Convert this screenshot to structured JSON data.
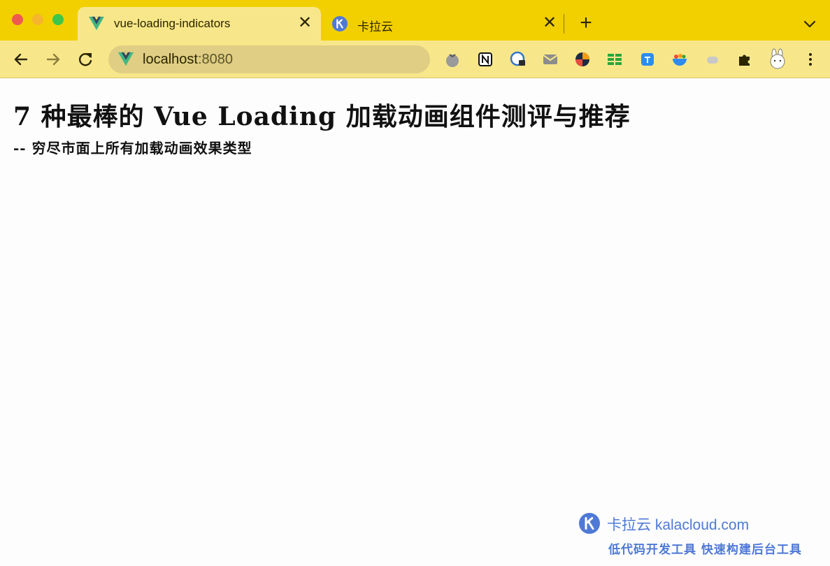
{
  "browser": {
    "tabs": [
      {
        "title": "vue-loading-indicators",
        "favicon": "vue-logo-icon",
        "active": true
      },
      {
        "title": "卡拉云",
        "favicon": "kalacloud-logo-icon",
        "active": false
      }
    ],
    "close_glyph": "✕",
    "new_tab_glyph": "+",
    "address": {
      "host": "localhost",
      "port": ":8080"
    },
    "extensions": [
      "tomato-icon",
      "notion-icon",
      "password-lock-icon",
      "mail-icon",
      "colorful-circle-icon",
      "table-grid-icon",
      "translate-icon",
      "bowl-icon",
      "cloud-icon",
      "puzzle-icon",
      "rabbit-icon"
    ],
    "colors": {
      "tabstrip": "#f2d000",
      "toolbar": "#f8e78a",
      "omnibox": "#dfce83",
      "accent_blue": "#4f79d6"
    }
  },
  "page": {
    "title": "7 种最棒的 Vue Loading 加载动画组件测评与推荐",
    "subtitle": "-- 穷尽市面上所有加载动画效果类型"
  },
  "watermark": {
    "brand": "卡拉云 kalacloud.com",
    "tagline": "低代码开发工具 快速构建后台工具"
  }
}
